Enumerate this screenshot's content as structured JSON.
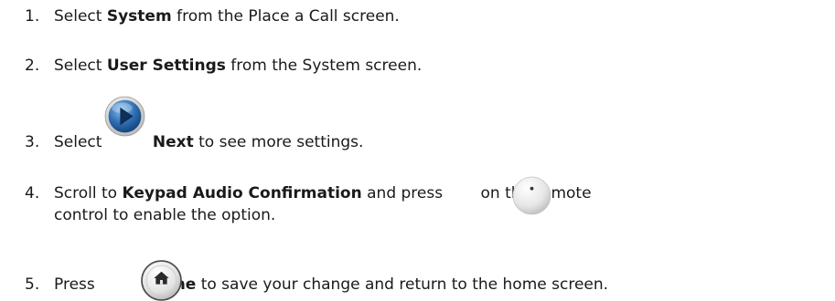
{
  "steps": [
    {
      "num": "1.",
      "pre": "Select ",
      "bold": "System",
      "post": " from the Place a Call screen."
    },
    {
      "num": "2.",
      "pre": "Select ",
      "bold": "User Settings",
      "post": " from the System screen."
    },
    {
      "num": "3.",
      "pre": "Select ",
      "icon": "next-icon",
      "bold": "Next",
      "post": " to see more settings."
    },
    {
      "num": "4.",
      "pre": "Scroll to ",
      "bold": "Keypad Audio Confirmation",
      "mid": " and press ",
      "icon": "select-icon",
      "post": "on the remote",
      "cont": "control to enable the option."
    },
    {
      "num": "5.",
      "pre": "Press ",
      "icon": "home-icon",
      "bold": "Home",
      "post": " to save your change and return to the home screen."
    }
  ],
  "colors": {
    "text": "#1a1a1a",
    "next_icon_blue": "#2f6fb3",
    "icon_silver": "#e4e4e4"
  }
}
